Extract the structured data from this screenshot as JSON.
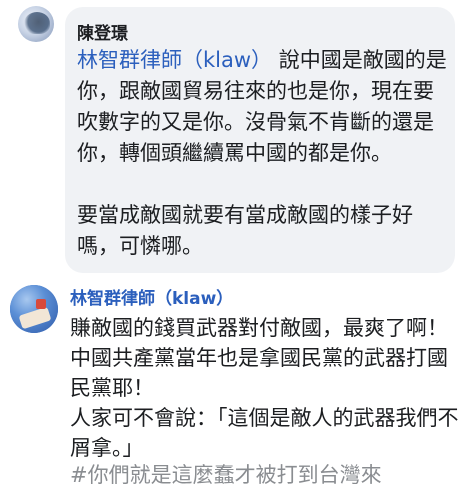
{
  "comments": [
    {
      "author": "陳登璟",
      "mention": "林智群律師（klaw）",
      "text": " 說中國是敵國的是你，跟敵國貿易往來的也是你，現在要吹數字的又是你。沒骨氣不肯斷的還是你，轉個頭繼續罵中國的都是你。\n\n要當成敵國就要有當成敵國的樣子好嗎，可憐哪。"
    },
    {
      "author": "林智群律師（klaw）",
      "text": "賺敵國的錢買武器對付敵國，最爽了啊！\n中國共產黨當年也是拿國民黨的武器打國民黨耶！\n人家可不會說：「這個是敵人的武器我們不屑拿。」",
      "hashtag": "#你們就是這麼蠢才被打到台灣來"
    }
  ]
}
